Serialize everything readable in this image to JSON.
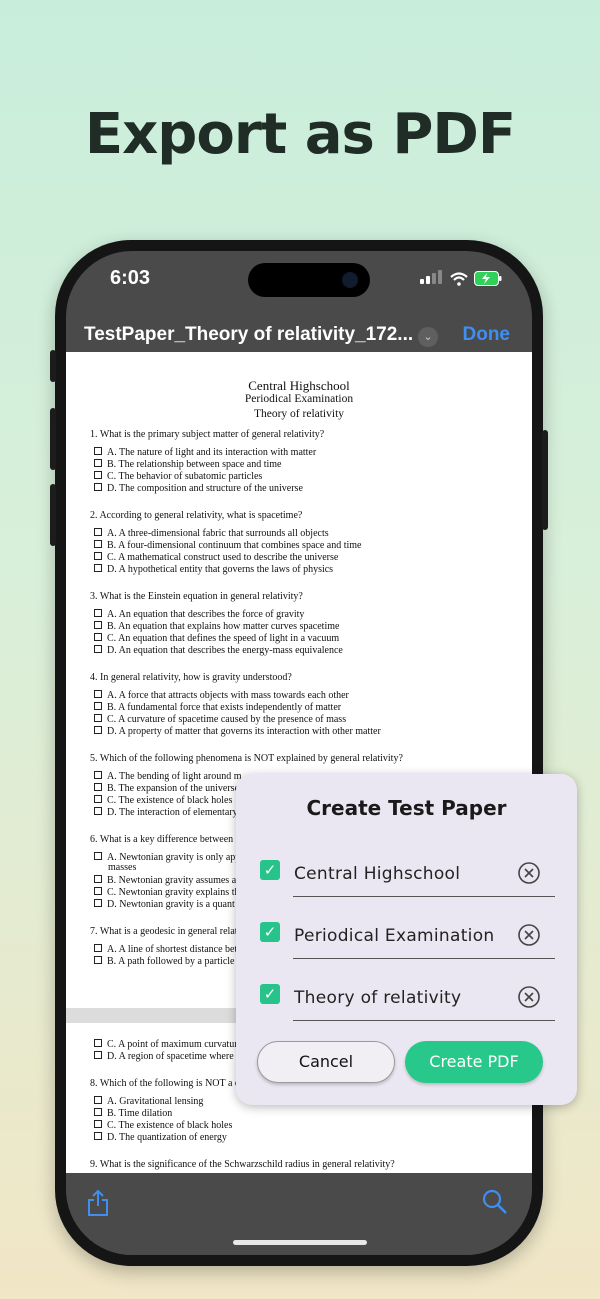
{
  "headline": "Export as PDF",
  "status_bar": {
    "time": "6:03"
  },
  "nav": {
    "title": "TestPaper_Theory of relativity_172...",
    "done_label": "Done"
  },
  "document": {
    "school": "Central Highschool",
    "exam": "Periodical Examination",
    "subject": "Theory of relativity",
    "questions": [
      {
        "q": "1. What is the primary subject matter of general relativity?",
        "options": [
          "A. The nature of light and its interaction with matter",
          "B. The relationship between space and time",
          "C. The behavior of subatomic particles",
          "D. The composition and structure of the universe"
        ]
      },
      {
        "q": "2. According to general relativity, what is spacetime?",
        "options": [
          "A. A three-dimensional fabric that surrounds all objects",
          "B. A four-dimensional continuum that combines space and time",
          "C. A mathematical construct used to describe the universe",
          "D. A hypothetical entity that governs the laws of physics"
        ]
      },
      {
        "q": "3. What is the Einstein equation in general relativity?",
        "options": [
          "A. An equation that describes the force of gravity",
          "B. An equation that explains how matter curves spacetime",
          "C. An equation that defines the speed of light in a vacuum",
          "D. An equation that describes the energy-mass equivalence"
        ]
      },
      {
        "q": "4. In general relativity, how is gravity understood?",
        "options": [
          "A. A force that attracts objects with mass towards each other",
          "B. A fundamental force that exists independently of matter",
          "C. A curvature of spacetime caused by the presence of mass",
          "D. A property of matter that governs its interaction with other matter"
        ]
      },
      {
        "q": "5. Which of the following phenomena is NOT explained by general relativity?",
        "options": [
          "A. The bending of light around m",
          "B. The expansion of the universe",
          "C. The existence of black holes",
          "D. The interaction of elementary"
        ]
      },
      {
        "q": "6. What is a key difference between N",
        "options": [
          "A. Newtonian gravity is only app",
          "masses",
          "B. Newtonian gravity assumes a",
          "C. Newtonian gravity explains th",
          "D. Newtonian gravity is a quant"
        ]
      },
      {
        "q": "7. What is a geodesic in general relat",
        "options": [
          "A. A line of shortest distance bet",
          "B. A path followed by a particle"
        ]
      }
    ],
    "page2": {
      "options_cont": [
        "C. A point of maximum curvatur",
        "D. A region of spacetime where g"
      ],
      "q8": "8. Which of the following is NOT a c",
      "q8_options": [
        "A. Gravitational lensing",
        "B. Time dilation",
        "C. The existence of black holes",
        "D. The quantization of energy"
      ],
      "q9": "9. What is the significance of the Schwarzschild radius in general relativity?"
    }
  },
  "modal": {
    "title": "Create Test Paper",
    "fields": [
      {
        "value": "Central Highschool",
        "checked": true
      },
      {
        "value": "Periodical Examination",
        "checked": true
      },
      {
        "value": "Theory of relativity",
        "checked": true
      }
    ],
    "cancel_label": "Cancel",
    "create_label": "Create PDF"
  },
  "colors": {
    "accent_green": "#27c88a",
    "link_blue": "#3f8ef0"
  },
  "icons": {
    "share": "share-icon",
    "search": "search-icon",
    "clear": "clear-circle-x-icon",
    "check": "checkbox-checked-icon"
  }
}
